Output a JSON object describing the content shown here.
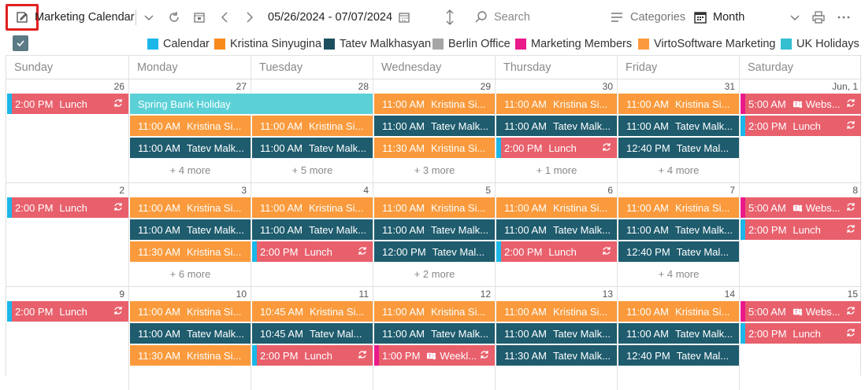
{
  "toolbar": {
    "calendar_name": "Marketing Calendar",
    "date_range": "05/26/2024 - 07/07/2024",
    "search_placeholder": "Search",
    "categories_label": "Categories",
    "view_label": "Month"
  },
  "colors": {
    "calendar": "#1ab7e8",
    "kristina": "#fa9a3c",
    "tatev": "#1e5c6e",
    "berlin": "#a8a8a8",
    "members": "#ea1a8a",
    "virto": "#fa9a3c",
    "uk": "#33bfcf",
    "lunch": "#e8606c",
    "holiday": "#5bd0d6",
    "teams": "#e44d83"
  },
  "legend": [
    {
      "label": "Calendar",
      "color": "#1ab7e8"
    },
    {
      "label": "Kristina Sinyugina",
      "color": "#f88a1c"
    },
    {
      "label": "Tatev Malkhasyan",
      "color": "#1e4f5e"
    },
    {
      "label": "Berlin Office",
      "color": "#a6a6a6"
    },
    {
      "label": "Marketing Members",
      "color": "#ea1a8a"
    },
    {
      "label": "VirtoSoftware Marketing",
      "color": "#fa9a3c"
    },
    {
      "label": "UK Holidays",
      "color": "#33bfcf"
    }
  ],
  "days": [
    "Sunday",
    "Monday",
    "Tuesday",
    "Wednesday",
    "Thursday",
    "Friday",
    "Saturday"
  ],
  "weeks": [
    {
      "nums": [
        "26",
        "27",
        "28",
        "29",
        "30",
        "31",
        "Jun, 1"
      ],
      "more": [
        "",
        "+ 4 more",
        "+ 5 more",
        "+ 3 more",
        "+ 1 more",
        "+ 4 more",
        ""
      ]
    },
    {
      "nums": [
        "2",
        "3",
        "4",
        "5",
        "6",
        "7",
        "8"
      ],
      "more": [
        "",
        "+ 6 more",
        "",
        "+ 2 more",
        "",
        "+ 4 more",
        ""
      ]
    },
    {
      "nums": [
        "9",
        "10",
        "11",
        "12",
        "13",
        "14",
        "15"
      ],
      "more": [
        "",
        "",
        "",
        "",
        "",
        "",
        ""
      ]
    }
  ],
  "events": {
    "w0_sun": {
      "time": "2:00 PM",
      "title": "Lunch"
    },
    "w0_holiday": {
      "title": "Spring Bank Holiday"
    },
    "w0_wed1": {
      "time": "11:00 AM",
      "title": "Kristina Si..."
    },
    "w0_thu1": {
      "time": "11:00 AM",
      "title": "Kristina Si..."
    },
    "w0_fri1": {
      "time": "11:00 AM",
      "title": "Kristina Si..."
    },
    "w0_sat1": {
      "time": "5:00 AM",
      "title": "Webs..."
    },
    "w0_mon2": {
      "time": "11:00 AM",
      "title": "Kristina Si..."
    },
    "w0_tue2": {
      "time": "11:00 AM",
      "title": "Kristina Si..."
    },
    "w0_wed2": {
      "time": "11:00 AM",
      "title": "Tatev Malk..."
    },
    "w0_thu2": {
      "time": "11:00 AM",
      "title": "Tatev Malk..."
    },
    "w0_fri2": {
      "time": "11:00 AM",
      "title": "Tatev Malk..."
    },
    "w0_sat2": {
      "time": "2:00 PM",
      "title": "Lunch"
    },
    "w0_mon3": {
      "time": "11:00 AM",
      "title": "Tatev Malk..."
    },
    "w0_tue3": {
      "time": "11:00 AM",
      "title": "Tatev Malk..."
    },
    "w0_wed3": {
      "time": "11:30 AM",
      "title": "Kristina Si..."
    },
    "w0_thu3": {
      "time": "2:00 PM",
      "title": "Lunch"
    },
    "w0_fri3": {
      "time": "12:40 PM",
      "title": "Tatev Mal..."
    },
    "w1_sun": {
      "time": "2:00 PM",
      "title": "Lunch"
    },
    "w1_mon1": {
      "time": "11:00 AM",
      "title": "Kristina Si..."
    },
    "w1_tue1": {
      "time": "11:00 AM",
      "title": "Kristina Si..."
    },
    "w1_wed1": {
      "time": "11:00 AM",
      "title": "Kristina Si..."
    },
    "w1_thu1": {
      "time": "11:00 AM",
      "title": "Kristina Si..."
    },
    "w1_fri1": {
      "time": "11:00 AM",
      "title": "Kristina Si..."
    },
    "w1_sat1": {
      "time": "5:00 AM",
      "title": "Webs..."
    },
    "w1_mon2": {
      "time": "11:00 AM",
      "title": "Tatev Malk..."
    },
    "w1_tue2": {
      "time": "11:00 AM",
      "title": "Tatev Malk..."
    },
    "w1_wed2": {
      "time": "11:00 AM",
      "title": "Tatev Malk..."
    },
    "w1_thu2": {
      "time": "11:00 AM",
      "title": "Tatev Malk..."
    },
    "w1_fri2": {
      "time": "11:00 AM",
      "title": "Tatev Malk..."
    },
    "w1_sat2": {
      "time": "2:00 PM",
      "title": "Lunch"
    },
    "w1_mon3": {
      "time": "11:30 AM",
      "title": "Kristina Si..."
    },
    "w1_tue3": {
      "time": "2:00 PM",
      "title": "Lunch"
    },
    "w1_wed3": {
      "time": "12:00 PM",
      "title": "Tatev Mal..."
    },
    "w1_thu3": {
      "time": "2:00 PM",
      "title": "Lunch"
    },
    "w1_fri3": {
      "time": "12:40 PM",
      "title": "Tatev Mal..."
    },
    "w2_sun": {
      "time": "2:00 PM",
      "title": "Lunch"
    },
    "w2_mon1": {
      "time": "11:00 AM",
      "title": "Kristina Si..."
    },
    "w2_tue1": {
      "time": "10:45 AM",
      "title": "Kristina Si..."
    },
    "w2_wed1": {
      "time": "11:00 AM",
      "title": "Kristina Si..."
    },
    "w2_thu1": {
      "time": "11:00 AM",
      "title": "Kristina Si..."
    },
    "w2_fri1": {
      "time": "11:00 AM",
      "title": "Kristina Si..."
    },
    "w2_sat1": {
      "time": "5:00 AM",
      "title": "Webs..."
    },
    "w2_mon2": {
      "time": "11:00 AM",
      "title": "Tatev Malk..."
    },
    "w2_tue2": {
      "time": "10:45 AM",
      "title": "Tatev Mal..."
    },
    "w2_wed2": {
      "time": "11:00 AM",
      "title": "Tatev Malk..."
    },
    "w2_thu2": {
      "time": "11:00 AM",
      "title": "Tatev Malk..."
    },
    "w2_fri2": {
      "time": "11:00 AM",
      "title": "Tatev Malk..."
    },
    "w2_sat2": {
      "time": "2:00 PM",
      "title": "Lunch"
    },
    "w2_mon3": {
      "time": "11:30 AM",
      "title": "Kristina Si..."
    },
    "w2_tue3": {
      "time": "2:00 PM",
      "title": "Lunch"
    },
    "w2_wed3": {
      "time": "1:00 PM",
      "title": "Weekl..."
    },
    "w2_thu3": {
      "time": "11:30 AM",
      "title": "Tatev Malk..."
    },
    "w2_fri3": {
      "time": "12:40 PM",
      "title": "Tatev Mal..."
    }
  }
}
